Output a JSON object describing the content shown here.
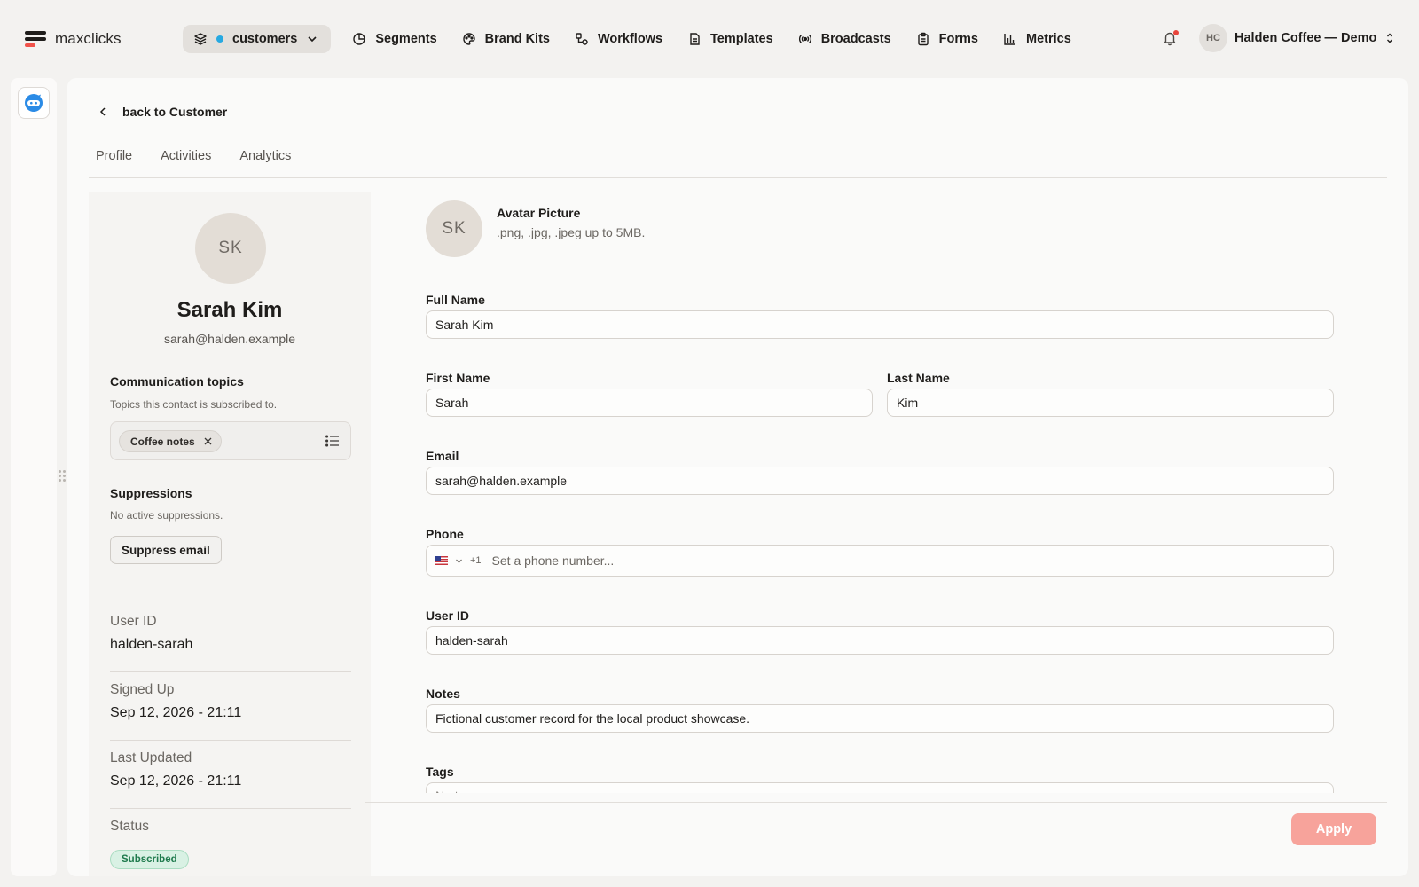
{
  "app": {
    "logo_text": "maxclicks"
  },
  "nav": {
    "workspace_label": "customers",
    "items": [
      {
        "label": "Segments",
        "icon": "pie-chart-icon"
      },
      {
        "label": "Brand Kits",
        "icon": "palette-icon"
      },
      {
        "label": "Workflows",
        "icon": "workflow-icon"
      },
      {
        "label": "Templates",
        "icon": "document-icon"
      },
      {
        "label": "Broadcasts",
        "icon": "broadcast-icon"
      },
      {
        "label": "Forms",
        "icon": "clipboard-icon"
      },
      {
        "label": "Metrics",
        "icon": "bar-chart-icon"
      }
    ]
  },
  "account": {
    "initials": "HC",
    "name": "Halden Coffee — Demo"
  },
  "page": {
    "back_label": "back to Customer",
    "tabs": [
      "Profile",
      "Activities",
      "Analytics"
    ]
  },
  "profile": {
    "initials": "SK",
    "name": "Sarah Kim",
    "email": "sarah@halden.example",
    "topics_title": "Communication topics",
    "topics_sub": "Topics this contact is subscribed to.",
    "topic_chip": "Coffee notes",
    "suppressions_title": "Suppressions",
    "suppressions_sub": "No active suppressions.",
    "suppress_button": "Suppress email",
    "meta": [
      {
        "label": "User ID",
        "value": "halden-sarah"
      },
      {
        "label": "Signed Up",
        "value": "Sep 12, 2026 - 21:11"
      },
      {
        "label": "Last Updated",
        "value": "Sep 12, 2026 - 21:11"
      },
      {
        "label": "Status",
        "value": "Subscribed"
      }
    ]
  },
  "form": {
    "avatar_initials": "SK",
    "avatar_title": "Avatar Picture",
    "avatar_hint": ".png, .jpg, .jpeg up to 5MB.",
    "full_name_label": "Full Name",
    "full_name": "Sarah Kim",
    "first_name_label": "First Name",
    "first_name": "Sarah",
    "last_name_label": "Last Name",
    "last_name": "Kim",
    "email_label": "Email",
    "email": "sarah@halden.example",
    "phone_label": "Phone",
    "phone_code": "+1",
    "phone_placeholder": "Set a phone number...",
    "user_id_label": "User ID",
    "user_id": "halden-sarah",
    "notes_label": "Notes",
    "notes": "Fictional customer record for the local product showcase.",
    "tags_label": "Tags",
    "tags_placeholder": "No tags"
  },
  "footer": {
    "apply_label": "Apply"
  },
  "colors": {
    "accent": "#f0524a",
    "apply_bg": "#f7a39b",
    "status_green": "#1f7a4d",
    "workspace_dot": "#27a9e1"
  }
}
